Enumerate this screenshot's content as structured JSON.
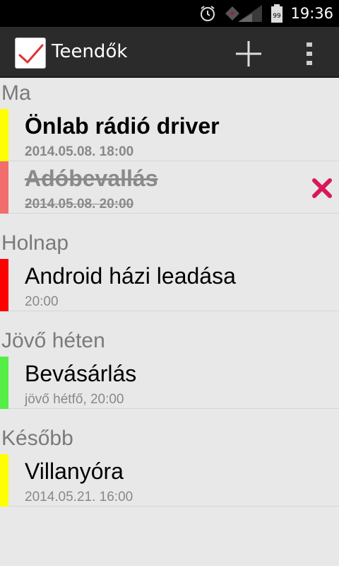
{
  "status_bar": {
    "time": "19:36",
    "battery": "99"
  },
  "app": {
    "title": "Teendők"
  },
  "sections": [
    {
      "header": "Ma",
      "items": [
        {
          "title": "Önlab rádió driver",
          "subtitle": "2014.05.08. 18:00",
          "color": "#ffff00",
          "state": "bold"
        },
        {
          "title": "Adóbevallás",
          "subtitle": "2014.05.08. 20:00",
          "color": "#f26d6d",
          "state": "done",
          "delete_icon": "close-icon"
        }
      ]
    },
    {
      "header": "Holnap",
      "items": [
        {
          "title": "Android házi leadása",
          "subtitle": "20:00",
          "color": "#ff0000",
          "state": "normal"
        }
      ]
    },
    {
      "header": "Jövő héten",
      "items": [
        {
          "title": "Bevásárlás",
          "subtitle": "jövő hétfő, 20:00",
          "color": "#55ee44",
          "state": "normal"
        }
      ]
    },
    {
      "header": "Később",
      "items": [
        {
          "title": "Villanyóra",
          "subtitle": "2014.05.21. 16:00",
          "color": "#ffff00",
          "state": "normal"
        }
      ]
    }
  ],
  "icons": {
    "alarm": "alarm-icon",
    "signal": "signal-icon",
    "battery": "battery-icon",
    "add": "add-icon",
    "overflow": "overflow-menu-icon",
    "app": "checkmark-icon"
  }
}
